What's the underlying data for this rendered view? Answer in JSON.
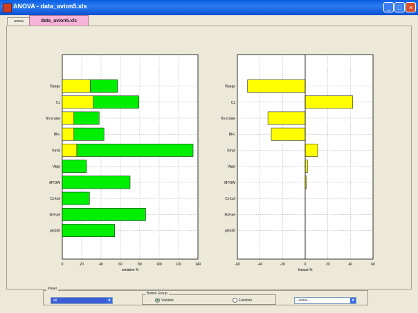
{
  "window": {
    "title": "ANOVA - data_avion5.xls"
  },
  "tabs": {
    "small_tab": "anova",
    "file_tab": "data_avion5.xls"
  },
  "colors": {
    "yellow": "#ffff00",
    "green": "#00ee00",
    "titlebar": "#0a5ee0"
  },
  "chart_data": [
    {
      "type": "bar",
      "orientation": "horizontal",
      "stacked": true,
      "categories": [
        "Range",
        "Cz",
        "fin-cruise",
        "BFL",
        "Kmot",
        "Vapp",
        "MTOW",
        "Cz-buf",
        "M-Fuel",
        "phi100"
      ],
      "series": [
        {
          "color": "#ffff00",
          "values": [
            29,
            32,
            12,
            12,
            15,
            0,
            0,
            0,
            0,
            0
          ]
        },
        {
          "color": "#00ee00",
          "values": [
            28,
            47,
            26,
            31,
            120,
            25,
            70,
            28,
            86,
            54
          ]
        }
      ],
      "xlabel": "variation %",
      "xlim": [
        0,
        140
      ],
      "xticks": [
        "0",
        "20",
        "40",
        "60",
        "80",
        "100",
        "120",
        "140"
      ],
      "grid": true
    },
    {
      "type": "bar",
      "orientation": "horizontal",
      "categories": [
        "Range",
        "Cz",
        "fin-cruise",
        "BFL",
        "Kmot",
        "Vapp",
        "MTOW",
        "Cz-buf",
        "M-Fuel",
        "phi100"
      ],
      "series": [
        {
          "color": "#ffff00",
          "values": [
            -51,
            42,
            -33,
            -30,
            11,
            2,
            1,
            0,
            0,
            0
          ]
        }
      ],
      "xlabel": "Impact %",
      "xlim": [
        -60,
        60
      ],
      "xticks": [
        "-60",
        "-40",
        "-20",
        "0",
        "20",
        "40",
        "60"
      ],
      "grid": true
    }
  ],
  "controls": {
    "panel_label": "Panel",
    "left_select": "all",
    "button_group_label": "Button Group",
    "radio_variable": "Variable",
    "radio_function": "Function",
    "variable_selected": true,
    "right_select": "--none--"
  }
}
